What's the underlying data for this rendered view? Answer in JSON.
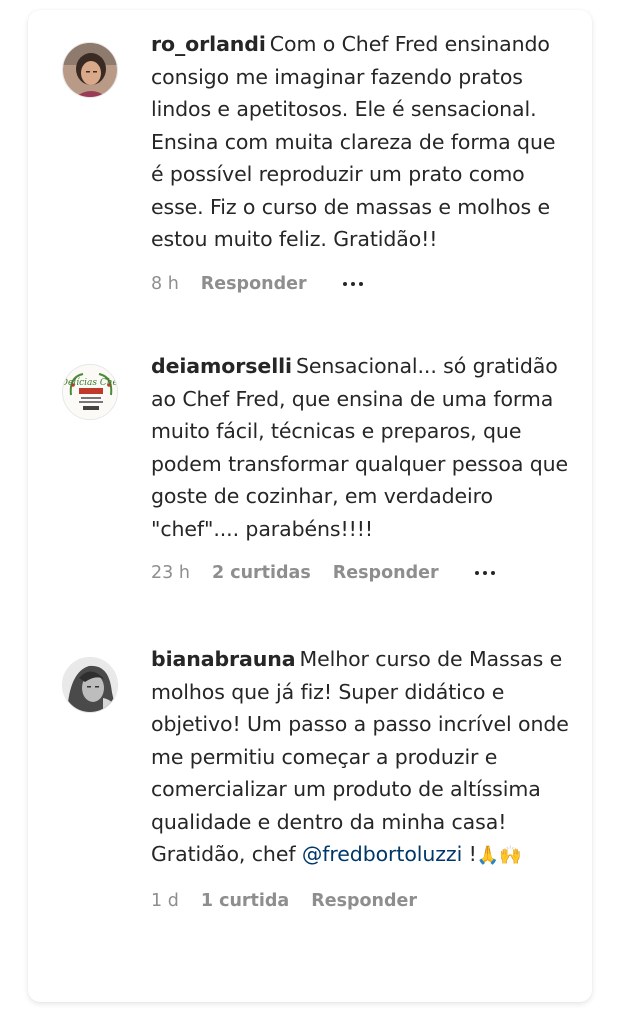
{
  "comments": [
    {
      "username": "ro_orlandi",
      "text": "Com o Chef Fred ensinando consigo me imaginar fazendo pratos lindos e apetitosos. Ele é sensacional. Ensina com muita clareza de forma que é possível reproduzir um prato como esse. Fiz o curso de massas e molhos e estou muito feliz. Gratidão!!",
      "time": "8 h",
      "likes": "",
      "reply_label": "Responder"
    },
    {
      "username": "deiamorselli",
      "text": "Sensacional... só gratidão ao Chef Fred, que ensina de uma forma muito fácil, técnicas e preparos, que podem transformar qualquer pessoa que goste de cozinhar, em verdadeiro \"chef\".... parabéns!!!!",
      "time": "23 h",
      "likes": "2 curtidas",
      "reply_label": "Responder"
    },
    {
      "username": "bianabrauna",
      "text": "Melhor curso de Massas e molhos que já fiz! Super didático e objetivo! Um passo a passo incrível onde me permitiu começar a produzir e comercializar um produto de altíssima qualidade e dentro da minha casa! Gratidão, chef",
      "mention": "@fredbortoluzzi",
      "text_end": " !",
      "emoji": [
        "🙏",
        "🙌"
      ],
      "time": "1 d",
      "likes": "1 curtida",
      "reply_label": "Responder"
    }
  ],
  "avatar_logo_text": "Delícias Chef"
}
